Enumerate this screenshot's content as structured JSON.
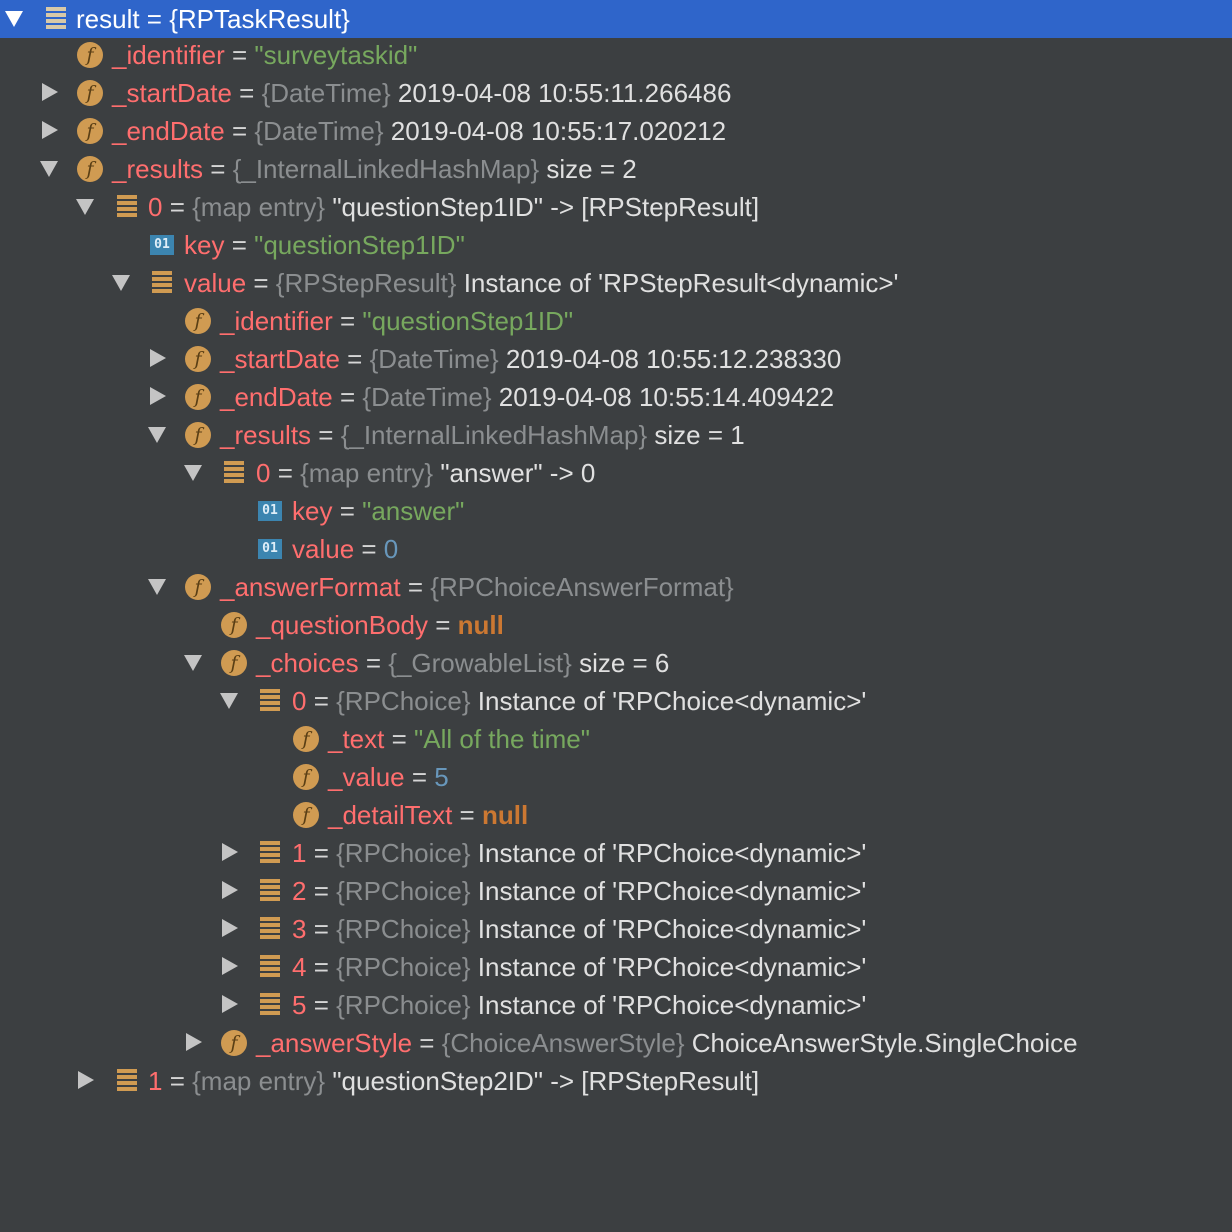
{
  "rows": [
    {
      "name": "result",
      "eq": " = ",
      "type": "",
      "value": "{RPTaskResult}",
      "value_style": "val"
    },
    {
      "name": "_identifier",
      "eq": " = ",
      "type": "",
      "value": "\"surveytaskid\"",
      "value_style": "str"
    },
    {
      "name": "_startDate",
      "eq": " = ",
      "type": "{DateTime} ",
      "value": "2019-04-08 10:55:11.266486",
      "value_style": "val"
    },
    {
      "name": "_endDate",
      "eq": " = ",
      "type": "{DateTime} ",
      "value": "2019-04-08 10:55:17.020212",
      "value_style": "val"
    },
    {
      "name": "_results",
      "eq": " = ",
      "type": "{_InternalLinkedHashMap} ",
      "value": "size = 2",
      "value_style": "val"
    },
    {
      "name": "0",
      "eq": " = ",
      "type": "{map entry} ",
      "value": "\"questionStep1ID\" -> [RPStepResult]",
      "value_style": "val"
    },
    {
      "name": "key",
      "eq": " = ",
      "type": "",
      "value": "\"questionStep1ID\"",
      "value_style": "str"
    },
    {
      "name": "value",
      "eq": " = ",
      "type": "{RPStepResult} ",
      "value": "Instance of 'RPStepResult<dynamic>'",
      "value_style": "val"
    },
    {
      "name": "_identifier",
      "eq": " = ",
      "type": "",
      "value": "\"questionStep1ID\"",
      "value_style": "str"
    },
    {
      "name": "_startDate",
      "eq": " = ",
      "type": "{DateTime} ",
      "value": "2019-04-08 10:55:12.238330",
      "value_style": "val"
    },
    {
      "name": "_endDate",
      "eq": " = ",
      "type": "{DateTime} ",
      "value": "2019-04-08 10:55:14.409422",
      "value_style": "val"
    },
    {
      "name": "_results",
      "eq": " = ",
      "type": "{_InternalLinkedHashMap} ",
      "value": "size = 1",
      "value_style": "val"
    },
    {
      "name": "0",
      "eq": " = ",
      "type": "{map entry} ",
      "value": "\"answer\" -> 0",
      "value_style": "val"
    },
    {
      "name": "key",
      "eq": " = ",
      "type": "",
      "value": "\"answer\"",
      "value_style": "str"
    },
    {
      "name": "value",
      "eq": " = ",
      "type": "",
      "value": "0",
      "value_style": "num"
    },
    {
      "name": "_answerFormat",
      "eq": " = ",
      "type": "{RPChoiceAnswerFormat}",
      "value": "",
      "value_style": "val"
    },
    {
      "name": "_questionBody",
      "eq": " = ",
      "type": "",
      "value": "null",
      "value_style": "kw"
    },
    {
      "name": "_choices",
      "eq": " = ",
      "type": "{_GrowableList} ",
      "value": "size = 6",
      "value_style": "val"
    },
    {
      "name": "0",
      "eq": " = ",
      "type": "{RPChoice} ",
      "value": "Instance of 'RPChoice<dynamic>'",
      "value_style": "val"
    },
    {
      "name": "_text",
      "eq": " = ",
      "type": "",
      "value": "\"All of the time\"",
      "value_style": "str"
    },
    {
      "name": "_value",
      "eq": " = ",
      "type": "",
      "value": "5",
      "value_style": "num"
    },
    {
      "name": "_detailText",
      "eq": " = ",
      "type": "",
      "value": "null",
      "value_style": "kw"
    },
    {
      "name": "1",
      "eq": " = ",
      "type": "{RPChoice} ",
      "value": "Instance of 'RPChoice<dynamic>'",
      "value_style": "val"
    },
    {
      "name": "2",
      "eq": " = ",
      "type": "{RPChoice} ",
      "value": "Instance of 'RPChoice<dynamic>'",
      "value_style": "val"
    },
    {
      "name": "3",
      "eq": " = ",
      "type": "{RPChoice} ",
      "value": "Instance of 'RPChoice<dynamic>'",
      "value_style": "val"
    },
    {
      "name": "4",
      "eq": " = ",
      "type": "{RPChoice} ",
      "value": "Instance of 'RPChoice<dynamic>'",
      "value_style": "val"
    },
    {
      "name": "5",
      "eq": " = ",
      "type": "{RPChoice} ",
      "value": "Instance of 'RPChoice<dynamic>'",
      "value_style": "val"
    },
    {
      "name": "_answerStyle",
      "eq": " = ",
      "type": "{ChoiceAnswerStyle} ",
      "value": "ChoiceAnswerStyle.SingleChoice",
      "value_style": "val"
    },
    {
      "name": "1",
      "eq": " = ",
      "type": "{map entry} ",
      "value": "\"questionStep2ID\" -> [RPStepResult]",
      "value_style": "val"
    }
  ],
  "icons": {
    "field_icon_glyph": "f",
    "primitive_icon_glyph": "01"
  },
  "colors": {
    "background": "#3c3f41",
    "selection": "#2f65ca",
    "field_name": "#ff6e6e",
    "type_name": "#8b8e90",
    "string_value": "#77a85e",
    "number_value": "#6897bb",
    "keyword_null": "#cc7832",
    "icon_orange": "#d09b52",
    "icon_blue": "#3c85b0"
  }
}
